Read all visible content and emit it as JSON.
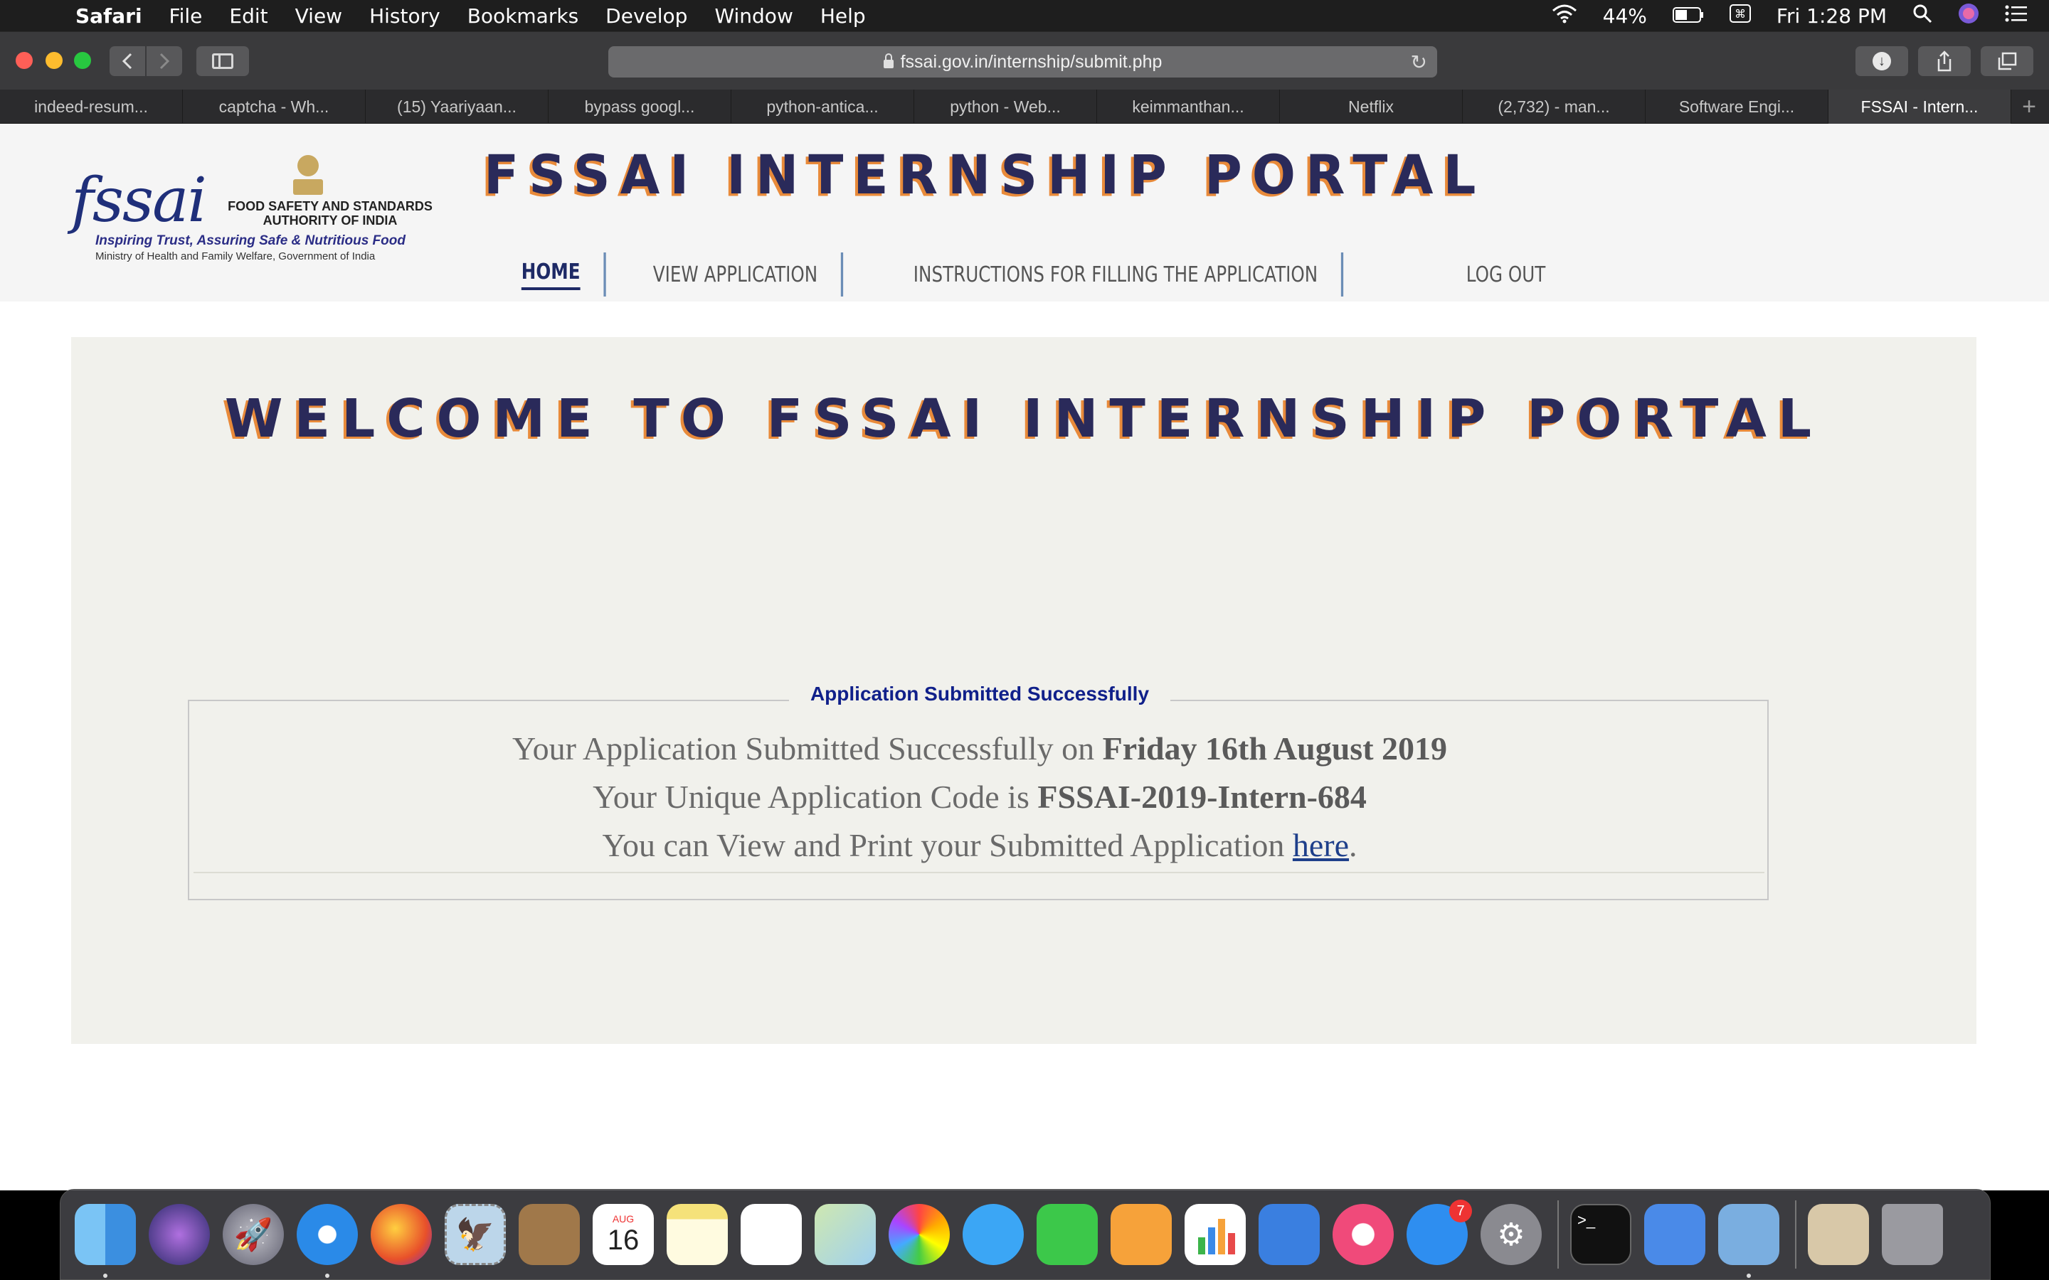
{
  "menubar": {
    "app": "Safari",
    "items": [
      "File",
      "Edit",
      "View",
      "History",
      "Bookmarks",
      "Develop",
      "Window",
      "Help"
    ],
    "battery": "44%",
    "clock": "Fri 1:28 PM"
  },
  "toolbar": {
    "url": "fssai.gov.in/internship/submit.php"
  },
  "tabs": [
    {
      "label": "indeed-resum..."
    },
    {
      "label": "captcha - Wh..."
    },
    {
      "label": "(15) Yaariyaan..."
    },
    {
      "label": "bypass googl..."
    },
    {
      "label": "python-antica..."
    },
    {
      "label": "python - Web..."
    },
    {
      "label": "keimmanthan..."
    },
    {
      "label": "Netflix"
    },
    {
      "label": "(2,732) - man..."
    },
    {
      "label": "Software Engi..."
    },
    {
      "label": "FSSAI - Intern..."
    }
  ],
  "header": {
    "logo_text": "fssai",
    "authority_line1": "FOOD SAFETY AND STANDARDS",
    "authority_line2": "AUTHORITY OF INDIA",
    "tagline": "Inspiring Trust, Assuring Safe & Nutritious Food",
    "ministry": "Ministry of Health and Family Welfare, Government of India",
    "portal_title": "FSSAI INTERNSHIP PORTAL"
  },
  "nav": {
    "home": "HOME",
    "view_application": "VIEW APPLICATION",
    "instructions": "INSTRUCTIONS FOR FILLING THE APPLICATION",
    "logout": "LOG OUT"
  },
  "main": {
    "welcome": "WELCOME TO FSSAI INTERNSHIP PORTAL",
    "legend": "Application Submitted Successfully",
    "line1_prefix": "Your Application Submitted Successfully on ",
    "line1_date": "Friday 16th August 2019",
    "line2_prefix": "Your Unique Application Code is ",
    "line2_code": "FSSAI-2019-Intern-684",
    "line3_prefix": "You can View and Print your Submitted Application ",
    "line3_link": "here",
    "line3_suffix": "."
  },
  "dock": {
    "calendar_month": "AUG",
    "calendar_day": "16",
    "appstore_badge": "7",
    "terminal_prompt": ">_"
  },
  "colors": {
    "title_navy": "#2a2a5a",
    "title_orange_shadow": "#e88a3a",
    "legend_blue": "#10208a",
    "panel_bg": "#f1f1ec",
    "nav_divider": "#6b8db6"
  }
}
